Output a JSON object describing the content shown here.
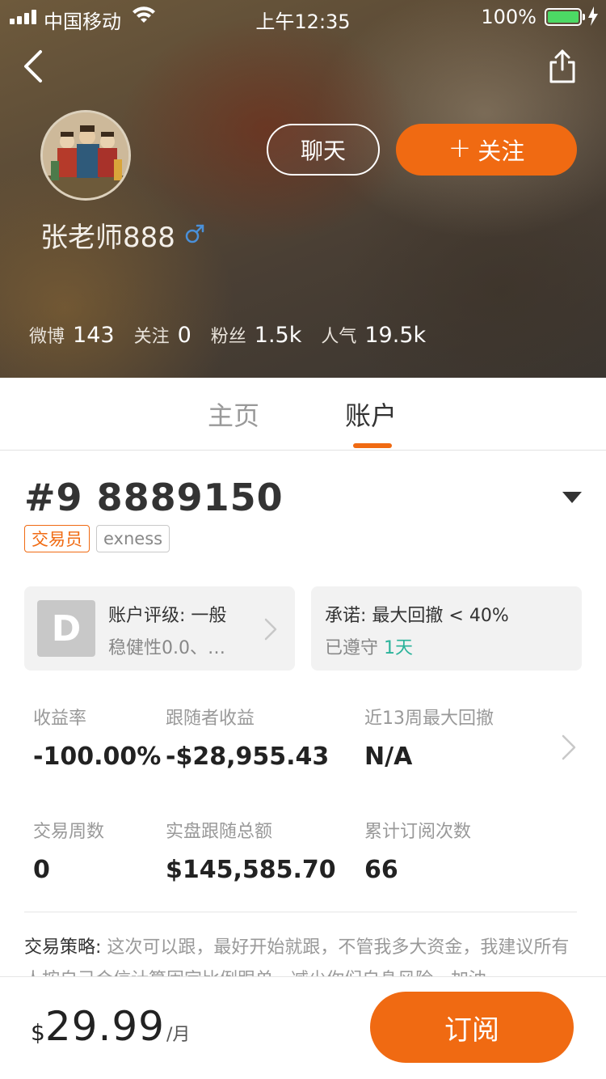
{
  "status_bar": {
    "carrier": "中国移动",
    "time": "上午12:35",
    "battery": "100%"
  },
  "profile": {
    "username": "张老师888",
    "gender_icon": "male-symbol-icon",
    "chat_label": "聊天",
    "follow_label": "关注",
    "follow_plus": "+",
    "stats": [
      {
        "label": "微博",
        "value": "143"
      },
      {
        "label": "关注",
        "value": "0"
      },
      {
        "label": "粉丝",
        "value": "1.5k"
      },
      {
        "label": "人气",
        "value": "19.5k"
      }
    ]
  },
  "tabs": [
    {
      "label": "主页",
      "active": false
    },
    {
      "label": "账户",
      "active": true
    }
  ],
  "account": {
    "title": "#9 8889150",
    "badges": [
      "交易员",
      "exness"
    ],
    "rating": {
      "grade": "D",
      "title": "账户评级: 一般",
      "subtitle": "稳健性0.0、…"
    },
    "promise": {
      "title": "承诺: 最大回撤 < 40%",
      "status": "已遵守",
      "days": "1天"
    },
    "metrics": [
      {
        "label": "收益率",
        "value": "-100.00%"
      },
      {
        "label": "跟随者收益",
        "value": "-$28,955.43"
      },
      {
        "label": "近13周最大回撤",
        "value": "N/A"
      },
      {
        "label": "交易周数",
        "value": "0"
      },
      {
        "label": "实盘跟随总额",
        "value": "$145,585.70"
      },
      {
        "label": "累计订阅次数",
        "value": "66"
      }
    ],
    "strategy_label": "交易策略:",
    "strategy_text": " 这次可以跟，最好开始就跟，不管我多大资金，我建议所有人按自己合信计算固定比例跟单，减少你们自身风险，加油"
  },
  "bottom": {
    "currency": "$",
    "price": "29.99",
    "unit": "/月",
    "subscribe_label": "订阅"
  },
  "colors": {
    "accent": "#f06a12",
    "success": "#2bb39b"
  }
}
